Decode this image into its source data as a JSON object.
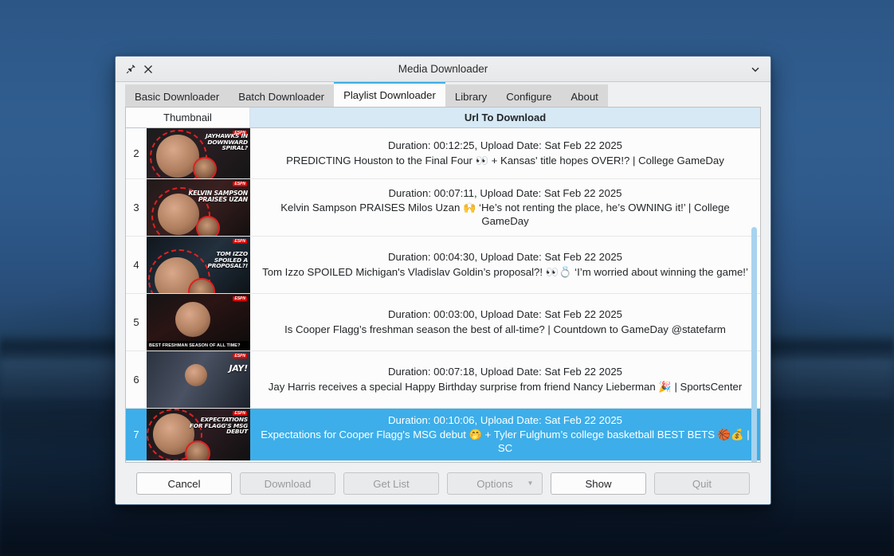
{
  "window": {
    "title": "Media Downloader",
    "pin_icon": "pin-icon",
    "close_icon": "close-icon",
    "menu_icon": "chevron-down-icon"
  },
  "tabs": [
    {
      "label": "Basic Downloader",
      "active": false
    },
    {
      "label": "Batch Downloader",
      "active": false
    },
    {
      "label": "Playlist Downloader",
      "active": true
    },
    {
      "label": "Library",
      "active": false
    },
    {
      "label": "Configure",
      "active": false
    },
    {
      "label": "About",
      "active": false
    }
  ],
  "table": {
    "columns": [
      {
        "key": "thumbnail",
        "label": "Thumbnail"
      },
      {
        "key": "url",
        "label": "Url To Download"
      }
    ],
    "rows": [
      {
        "index": "2",
        "meta": "Duration: 00:12:25, Upload Date: Sat Feb 22 2025",
        "title": "PREDICTING Houston to the Final Four 👀 + Kansas' title hopes OVER!? | College GameDay",
        "selected": false,
        "thumb_caption": "JAYHAWKS IN DOWNWARD SPIRAL?"
      },
      {
        "index": "3",
        "meta": "Duration: 00:07:11, Upload Date: Sat Feb 22 2025",
        "title": "Kelvin Sampson PRAISES Milos Uzan 🙌 ‘He’s not renting the place, he’s OWNING it!’ | College GameDay",
        "selected": false,
        "thumb_caption": "KELVIN SAMPSON PRAISES UZAN"
      },
      {
        "index": "4",
        "meta": "Duration: 00:04:30, Upload Date: Sat Feb 22 2025",
        "title": "Tom Izzo SPOILED Michigan's Vladislav Goldin’s proposal?! 👀💍 ‘I’m worried about winning the game!’",
        "selected": false,
        "thumb_caption": "TOM IZZO SPOILED A PROPOSAL?!"
      },
      {
        "index": "5",
        "meta": "Duration: 00:03:00, Upload Date: Sat Feb 22 2025",
        "title": "Is Cooper Flagg’s freshman season the best of all-time? | Countdown to GameDay @statefarm",
        "selected": false,
        "thumb_caption": "",
        "thumb_bottom": "BEST FRESHMAN SEASON OF ALL TIME?"
      },
      {
        "index": "6",
        "meta": "Duration: 00:07:18, Upload Date: Sat Feb 22 2025",
        "title": "Jay Harris receives a special Happy Birthday surprise from friend Nancy Lieberman 🎉 | SportsCenter",
        "selected": false,
        "thumb_caption": "JAY!"
      },
      {
        "index": "7",
        "meta": "Duration: 00:10:06, Upload Date: Sat Feb 22 2025",
        "title": "Expectations for Cooper Flagg's MSG debut 🤭 + Tyler Fulghum’s college basketball BEST BETS 🏀💰 | SC",
        "selected": true,
        "thumb_caption": "EXPECTATIONS FOR FLAGG'S MSG DEBUT"
      }
    ]
  },
  "buttons": [
    {
      "label": "Cancel",
      "enabled": true,
      "combo": false
    },
    {
      "label": "Download",
      "enabled": false,
      "combo": false
    },
    {
      "label": "Get List",
      "enabled": false,
      "combo": false
    },
    {
      "label": "Options",
      "enabled": false,
      "combo": true,
      "chevron": "▾"
    },
    {
      "label": "Show",
      "enabled": true,
      "combo": false
    },
    {
      "label": "Quit",
      "enabled": false,
      "combo": false
    }
  ],
  "colors": {
    "selection_blue": "#3daee9",
    "header_blue": "#d6e9f5",
    "tab_active_accent": "#3daee9",
    "scrollbar_thumb": "#a8d3ef",
    "window_bg": "#eff0f1"
  }
}
